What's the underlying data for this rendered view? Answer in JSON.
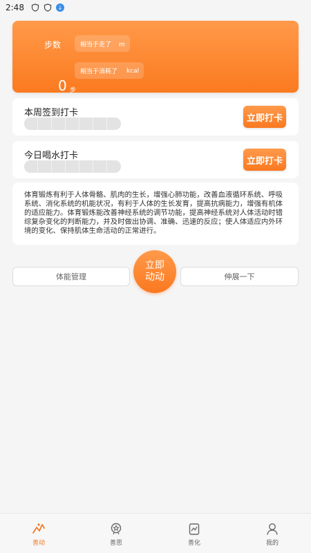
{
  "status_bar": {
    "time": "2:48"
  },
  "summary": {
    "steps_label": "步数",
    "steps_value": "0",
    "steps_unit": "步",
    "distance_text": "相当于走了",
    "distance_unit": "m",
    "calories_text": "相当于消耗了",
    "calories_unit": "kcal"
  },
  "weekly_checkin": {
    "title": "本周签到打卡",
    "button": "立即打卡"
  },
  "water_checkin": {
    "title": "今日喝水打卡",
    "button": "立即打卡"
  },
  "description": "体育锻炼有利于人体骨骼、肌肉的生长，增强心肺功能，改善血液循环系统、呼吸系统、消化系统的机能状况，有利于人体的生长发育，提高抗病能力，增强有机体的适应能力。体育锻炼能改善神经系统的调节功能，提高神经系统对人体活动时错综复杂变化的判断能力，并及时做出协调、准确、迅速的反应；使人体适应内外环境的变化、保持肌体生命活动的正常进行。",
  "actions": {
    "fitness": "体能管理",
    "start_line1": "立即",
    "start_line2": "动动",
    "stretch": "伸展一下"
  },
  "tabs": [
    {
      "label": "善动",
      "icon": "activity-icon",
      "active": true
    },
    {
      "label": "善思",
      "icon": "brain-icon",
      "active": false
    },
    {
      "label": "善化",
      "icon": "chart-icon",
      "active": false
    },
    {
      "label": "我的",
      "icon": "user-icon",
      "active": false
    }
  ],
  "colors": {
    "accent": "#fb7a1f",
    "background": "#f5f5f5"
  }
}
